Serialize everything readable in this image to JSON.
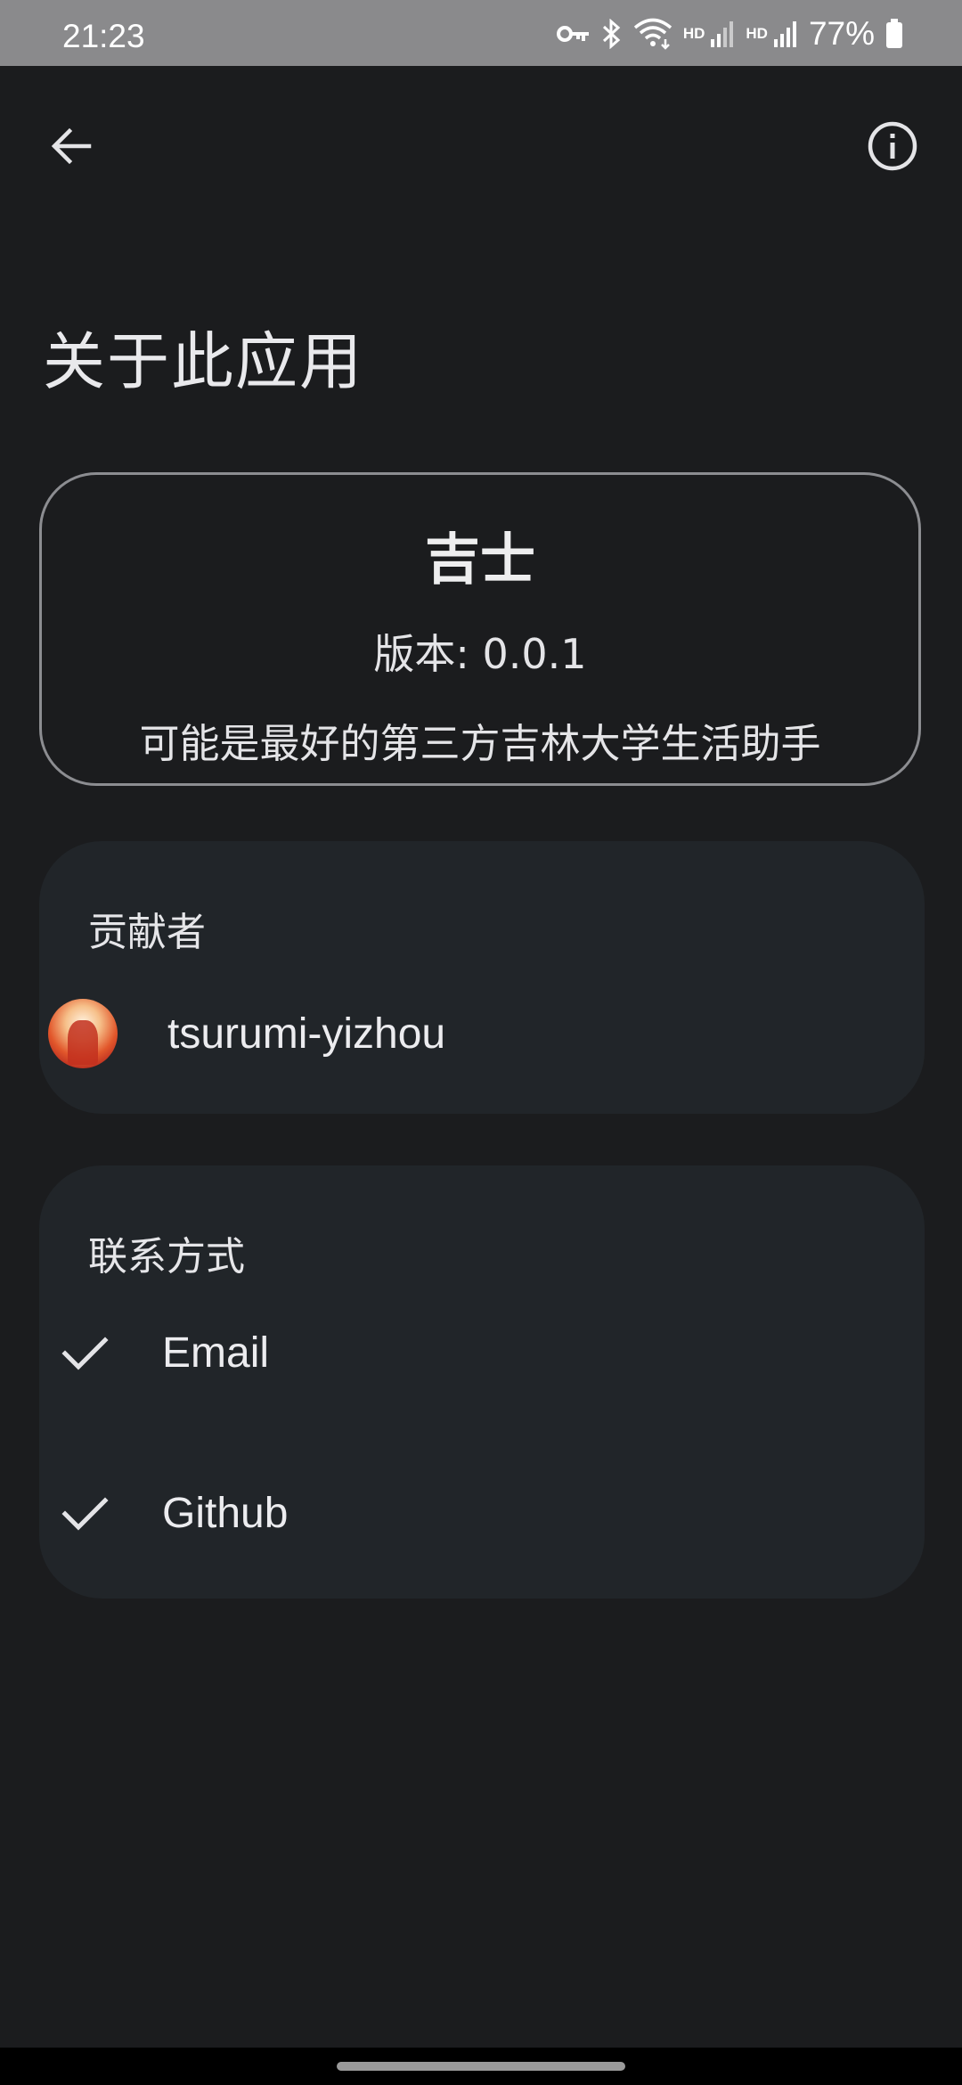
{
  "status_bar": {
    "time": "21:23",
    "hd1": "HD",
    "hd2": "HD",
    "battery": "77%",
    "icons": [
      "vpn-key-icon",
      "bluetooth-icon",
      "wifi-icon",
      "signal-icon",
      "signal-icon",
      "battery-icon"
    ]
  },
  "app_bar": {
    "back_icon": "arrow-back-icon",
    "info_icon": "info-icon"
  },
  "page_title": "关于此应用",
  "app_info": {
    "name": "吉士",
    "version": "版本: 0.0.1",
    "slogan": "可能是最好的第三方吉林大学生活助手"
  },
  "contributors": {
    "title": "贡献者",
    "items": [
      {
        "name": "tsurumi-yizhou"
      }
    ]
  },
  "contact": {
    "title": "联系方式",
    "items": [
      {
        "label": "Email",
        "icon": "check-icon"
      },
      {
        "label": "Github",
        "icon": "check-icon"
      }
    ]
  },
  "colors": {
    "background": "#1b1c1e",
    "card": "#212529",
    "outline": "#8c8d91",
    "status_bar": "#8a8a8c"
  }
}
